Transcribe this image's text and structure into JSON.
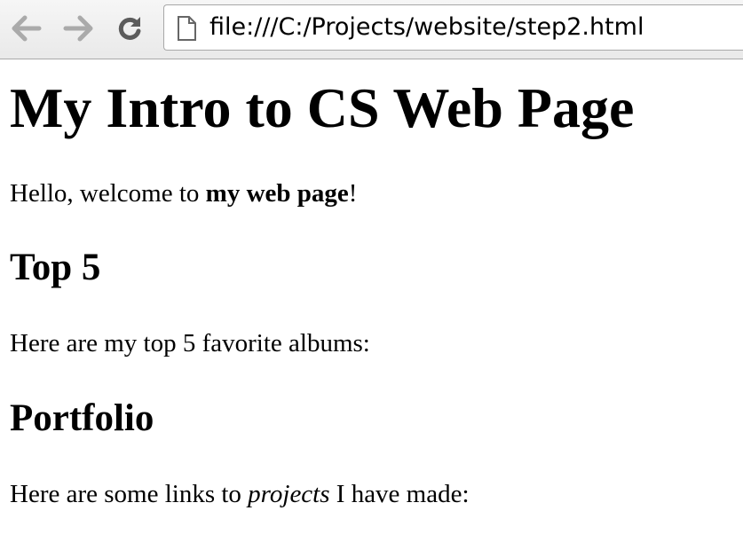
{
  "browser": {
    "address_url": "file:///C:/Projects/website/step2.html",
    "icons": {
      "back": "back-arrow-icon",
      "forward": "forward-arrow-icon",
      "reload": "reload-icon",
      "page": "page-icon"
    }
  },
  "page": {
    "title": "My Intro to CS Web Page",
    "intro": {
      "before": "Hello, welcome to ",
      "bold": "my web page",
      "after": "!"
    },
    "top5": {
      "heading": "Top 5",
      "text": "Here are my top 5 favorite albums:"
    },
    "portfolio": {
      "heading": "Portfolio",
      "before": "Here are some links to ",
      "italic": "projects",
      "after": " I have made:"
    }
  }
}
